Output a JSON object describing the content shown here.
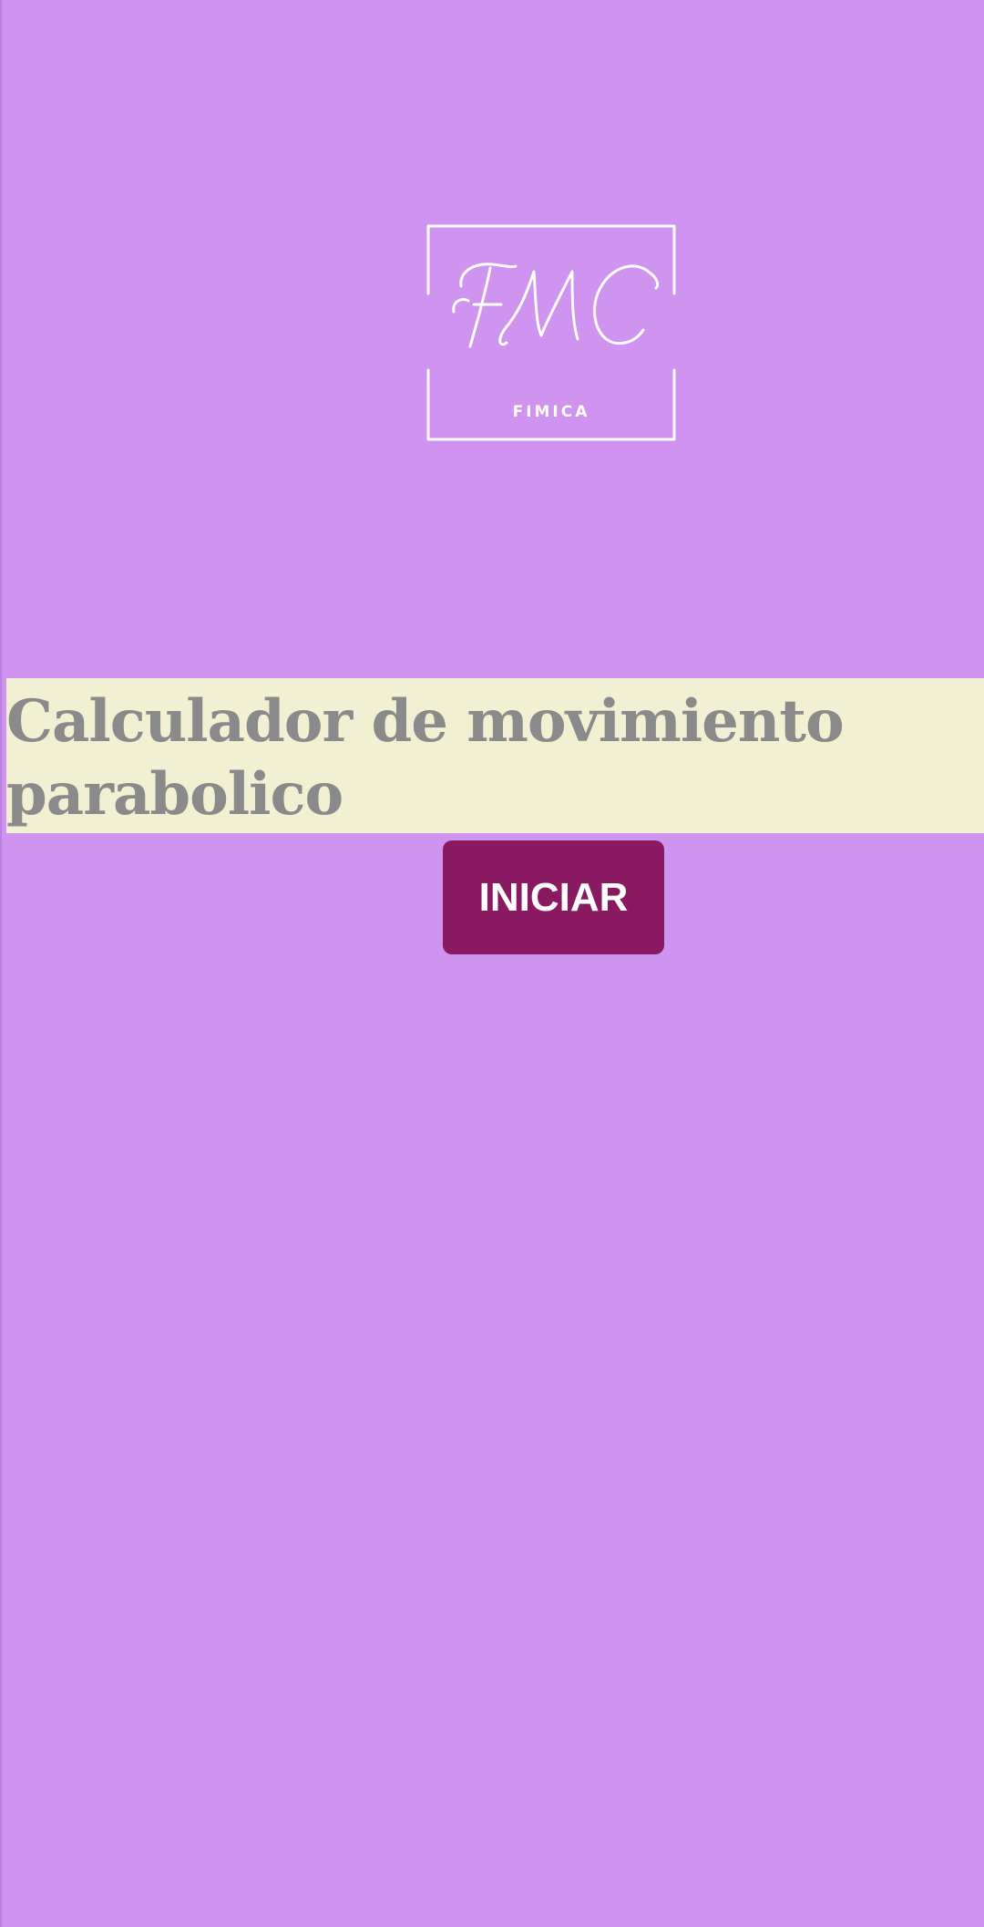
{
  "colors": {
    "background": "#CF93F0",
    "title_band": "#F2F0D2",
    "title_text": "#8A8A8A",
    "button": "#891A61",
    "button_text": "#FFFFFF",
    "logo": "#FFFFFF"
  },
  "logo": {
    "monogram": "FMC",
    "caption": "FIMICA"
  },
  "title": {
    "text": "Calculador de movimiento parabolico"
  },
  "start_button": {
    "label": "INICIAR"
  }
}
